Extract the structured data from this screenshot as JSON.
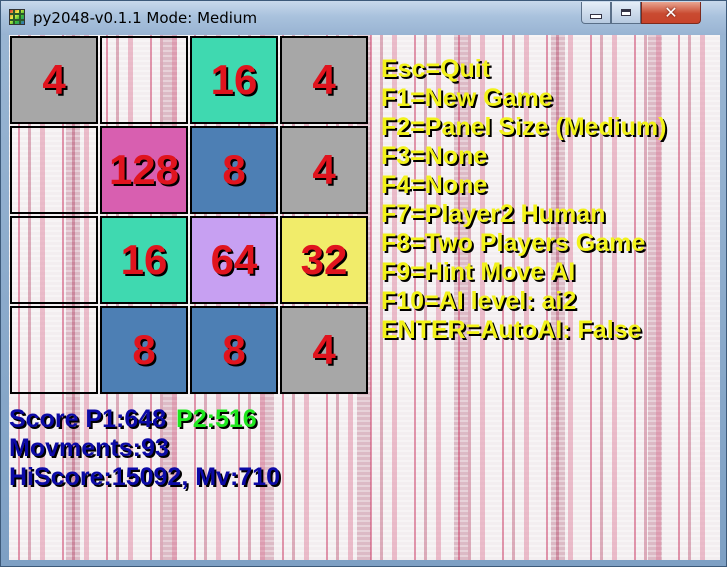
{
  "window": {
    "title": "py2048-v0.1.1 Mode: Medium",
    "close_label": "✕"
  },
  "board": {
    "rows": 4,
    "cols": 4,
    "tiles": [
      [
        {
          "value": "4",
          "color": "#a7a7a7"
        },
        {
          "value": "",
          "color": ""
        },
        {
          "value": "16",
          "color": "#3fd9b0"
        },
        {
          "value": "4",
          "color": "#a7a7a7"
        }
      ],
      [
        {
          "value": "",
          "color": ""
        },
        {
          "value": "128",
          "color": "#d85fb0"
        },
        {
          "value": "8",
          "color": "#4d7fb4"
        },
        {
          "value": "4",
          "color": "#a7a7a7"
        }
      ],
      [
        {
          "value": "",
          "color": ""
        },
        {
          "value": "16",
          "color": "#3fd9b0"
        },
        {
          "value": "64",
          "color": "#c7a0f2"
        },
        {
          "value": "32",
          "color": "#f1ec6a"
        }
      ],
      [
        {
          "value": "",
          "color": ""
        },
        {
          "value": "8",
          "color": "#4d7fb4"
        },
        {
          "value": "8",
          "color": "#4d7fb4"
        },
        {
          "value": "4",
          "color": "#a7a7a7"
        }
      ]
    ]
  },
  "help": [
    "Esc=Quit",
    "F1=New Game",
    "F2=Panel Size (Medium)",
    "F3=None",
    "F4=None",
    "F7=Player2 Human",
    "F8=Two Players Game",
    "F9=Hint Move AI",
    "F10=AI level: ai2",
    "ENTER=AutoAI: False"
  ],
  "stats": {
    "score_p1": "Score P1:648",
    "score_p2": "P2:516",
    "movements": "Movments:93",
    "hiscore": "HiScore:15092, Mv:710"
  },
  "colors": {
    "tile_text": "#e0141e",
    "help_text": "#f2f21a",
    "p1_text": "#0c0aa6",
    "p2_text": "#1ee61e"
  }
}
